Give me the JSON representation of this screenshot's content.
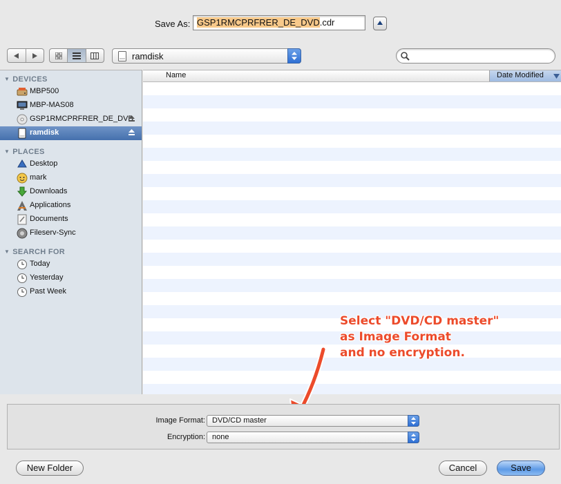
{
  "save_as": {
    "label": "Save As:",
    "filename_selected": "GSP1RMCPRFRER_DE_DVD",
    "filename_ext": ".cdr"
  },
  "toolbar": {
    "location": "ramdisk",
    "search_placeholder": ""
  },
  "list": {
    "col_name": "Name",
    "col_date": "Date Modified"
  },
  "sidebar": {
    "devices_header": "DEVICES",
    "devices": [
      {
        "label": "MBP500",
        "icon": "hard-drive-icon"
      },
      {
        "label": "MBP-MAS08",
        "icon": "computer-icon"
      },
      {
        "label": "GSP1RMCPRFRER_DE_DVD",
        "icon": "dvd-icon"
      },
      {
        "label": "ramdisk",
        "icon": "drive-icon"
      }
    ],
    "places_header": "PLACES",
    "places": [
      {
        "label": "Desktop",
        "icon": "desktop-icon"
      },
      {
        "label": "mark",
        "icon": "home-icon"
      },
      {
        "label": "Downloads",
        "icon": "downloads-icon"
      },
      {
        "label": "Applications",
        "icon": "applications-icon"
      },
      {
        "label": "Documents",
        "icon": "documents-icon"
      },
      {
        "label": "Fileserv-Sync",
        "icon": "folder-icon"
      }
    ],
    "search_header": "SEARCH FOR",
    "searches": [
      {
        "label": "Today",
        "icon": "clock-icon"
      },
      {
        "label": "Yesterday",
        "icon": "clock-icon"
      },
      {
        "label": "Past Week",
        "icon": "clock-icon"
      }
    ]
  },
  "annotation": {
    "line1": "Select \"DVD/CD master\"",
    "line2": "as Image Format",
    "line3": "and no encryption."
  },
  "options": {
    "image_format_label": "Image Format:",
    "image_format_value": "DVD/CD master",
    "encryption_label": "Encryption:",
    "encryption_value": "none"
  },
  "buttons": {
    "new_folder": "New Folder",
    "cancel": "Cancel",
    "save": "Save"
  },
  "colors": {
    "annotation": "#ec4b2b",
    "selection": "#4570ad",
    "filename_highlight": "#f8c98a"
  }
}
